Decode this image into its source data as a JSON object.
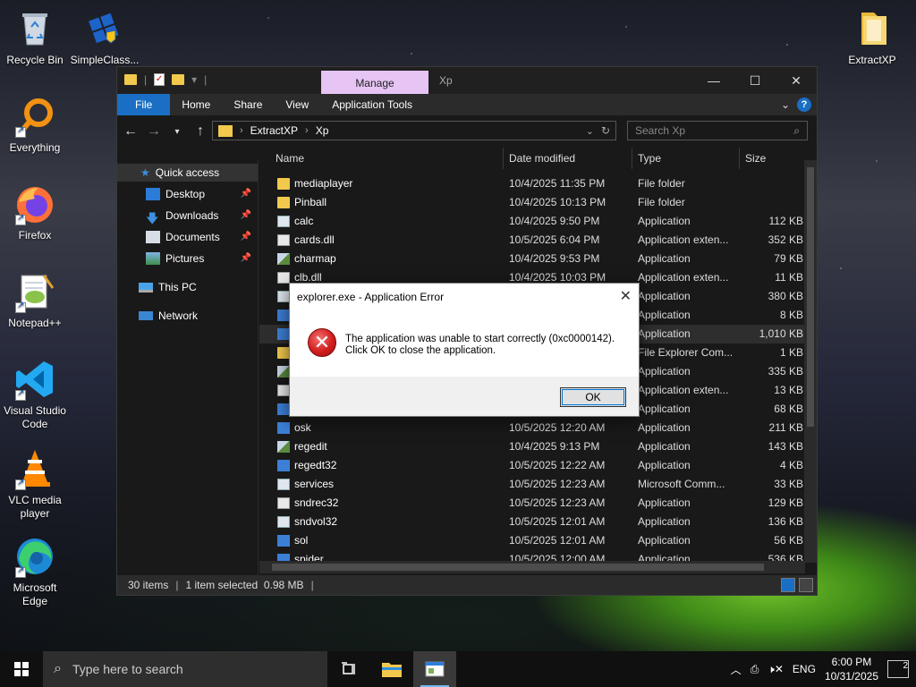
{
  "desktop": {
    "icons": [
      {
        "label": "Recycle Bin",
        "icon": "recycle-bin-icon"
      },
      {
        "label": "SimpleClass...",
        "icon": "simpleclassic-icon"
      },
      {
        "label": "Everything",
        "icon": "everything-icon"
      },
      {
        "label": "Firefox",
        "icon": "firefox-icon"
      },
      {
        "label": "Notepad++",
        "icon": "notepadpp-icon"
      },
      {
        "label": "Visual Studio Code",
        "icon": "vscode-icon"
      },
      {
        "label": "VLC media player",
        "icon": "vlc-icon"
      },
      {
        "label": "Microsoft Edge",
        "icon": "edge-icon"
      },
      {
        "label": "ExtractXP",
        "icon": "folder-icon"
      }
    ]
  },
  "explorer": {
    "manage_tab": "Manage",
    "context_title": "Xp",
    "ribbon_tabs": [
      "File",
      "Home",
      "Share",
      "View",
      "Application Tools"
    ],
    "breadcrumb": [
      "ExtractXP",
      "Xp"
    ],
    "search_placeholder": "Search Xp",
    "nav": {
      "quick_access": "Quick access",
      "pinned": [
        "Desktop",
        "Downloads",
        "Documents",
        "Pictures"
      ],
      "this_pc": "This PC",
      "network": "Network"
    },
    "columns": [
      "Name",
      "Date modified",
      "Type",
      "Size"
    ],
    "files": [
      {
        "name": "mediaplayer",
        "date": "10/4/2025 11:35 PM",
        "type": "File folder",
        "size": ""
      },
      {
        "name": "Pinball",
        "date": "10/4/2025 10:13 PM",
        "type": "File folder",
        "size": ""
      },
      {
        "name": "calc",
        "date": "10/4/2025 9:50 PM",
        "type": "Application",
        "size": "112 KB"
      },
      {
        "name": "cards.dll",
        "date": "10/5/2025 6:04 PM",
        "type": "Application exten...",
        "size": "352 KB"
      },
      {
        "name": "charmap",
        "date": "10/4/2025 9:53 PM",
        "type": "Application",
        "size": "79 KB"
      },
      {
        "name": "clb.dll",
        "date": "10/4/2025 10:03 PM",
        "type": "Application exten...",
        "size": "11 KB"
      },
      {
        "name": "",
        "date": "",
        "type": "Application",
        "size": "380 KB"
      },
      {
        "name": "",
        "date": "",
        "type": "Application",
        "size": "8 KB"
      },
      {
        "name": "",
        "date": "",
        "type": "Application",
        "size": "1,010 KB"
      },
      {
        "name": "",
        "date": "",
        "type": "File Explorer Com...",
        "size": "1 KB"
      },
      {
        "name": "",
        "date": "",
        "type": "Application",
        "size": "335 KB"
      },
      {
        "name": "",
        "date": "",
        "type": "Application exten...",
        "size": "13 KB"
      },
      {
        "name": "",
        "date": "",
        "type": "Application",
        "size": "68 KB"
      },
      {
        "name": "osk",
        "date": "10/5/2025 12:20 AM",
        "type": "Application",
        "size": "211 KB"
      },
      {
        "name": "regedit",
        "date": "10/4/2025 9:13 PM",
        "type": "Application",
        "size": "143 KB"
      },
      {
        "name": "regedt32",
        "date": "10/5/2025 12:22 AM",
        "type": "Application",
        "size": "4 KB"
      },
      {
        "name": "services",
        "date": "10/5/2025 12:23 AM",
        "type": "Microsoft Comm...",
        "size": "33 KB"
      },
      {
        "name": "sndrec32",
        "date": "10/5/2025 12:23 AM",
        "type": "Application",
        "size": "129 KB"
      },
      {
        "name": "sndvol32",
        "date": "10/5/2025 12:01 AM",
        "type": "Application",
        "size": "136 KB"
      },
      {
        "name": "sol",
        "date": "10/5/2025 12:01 AM",
        "type": "Application",
        "size": "56 KB"
      },
      {
        "name": "spider",
        "date": "10/5/2025 12:00 AM",
        "type": "Application",
        "size": "536 KB"
      }
    ],
    "status": {
      "count": "30 items",
      "selected": "1 item selected  0.98 MB"
    }
  },
  "dialog": {
    "title": "explorer.exe - Application Error",
    "message_line1": "The application was unable to start correctly (0xc0000142).",
    "message_line2": "Click OK to close the application.",
    "ok_label": "OK"
  },
  "taskbar": {
    "search_placeholder": "Type here to search",
    "language": "ENG",
    "time": "6:00 PM",
    "date": "10/31/2025",
    "notifications": "2"
  }
}
